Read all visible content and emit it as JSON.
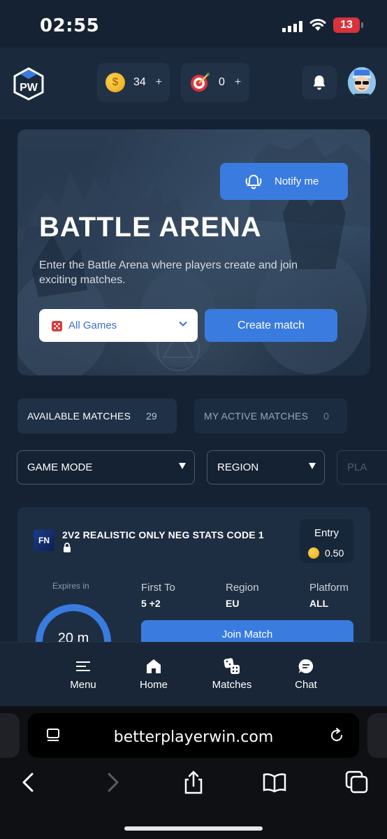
{
  "status_bar": {
    "time": "02:55",
    "battery": "13"
  },
  "header": {
    "logo_text": "PW",
    "coins": {
      "value": "34",
      "plus": "+"
    },
    "targets": {
      "value": "0",
      "plus": "+"
    }
  },
  "hero": {
    "notify_label": "Notify me",
    "title": "BATTLE ARENA",
    "description": "Enter the Battle Arena where players create and join exciting matches.",
    "games_select": "All Games",
    "create_label": "Create match"
  },
  "tabs": [
    {
      "label": "AVAILABLE MATCHES",
      "count": "29"
    },
    {
      "label": "MY ACTIVE MATCHES",
      "count": "0"
    }
  ],
  "filters": [
    {
      "label": "GAME MODE"
    },
    {
      "label": "REGION"
    },
    {
      "label": "PLA"
    }
  ],
  "match": {
    "thumb_text": "FN",
    "title": "2V2 REALISTIC ONLY NEG STATS CODE 1",
    "entry_label": "Entry",
    "entry_value": "0.50",
    "expires_label": "Expires in",
    "timer_text": "20 m",
    "first_to_label": "First To",
    "first_to_value": "5 +2",
    "region_label": "Region",
    "region_value": "EU",
    "platform_label": "Platform",
    "platform_value": "ALL",
    "join_label": "Join Match"
  },
  "nav": [
    {
      "label": "Menu",
      "icon": "menu-icon"
    },
    {
      "label": "Home",
      "icon": "home-icon"
    },
    {
      "label": "Matches",
      "icon": "dice-icon"
    },
    {
      "label": "Chat",
      "icon": "chat-icon"
    }
  ],
  "browser": {
    "url": "betterplayerwin.com"
  },
  "colors": {
    "accent": "#3a7be0",
    "background": "#152233",
    "card": "#1e2e42"
  }
}
